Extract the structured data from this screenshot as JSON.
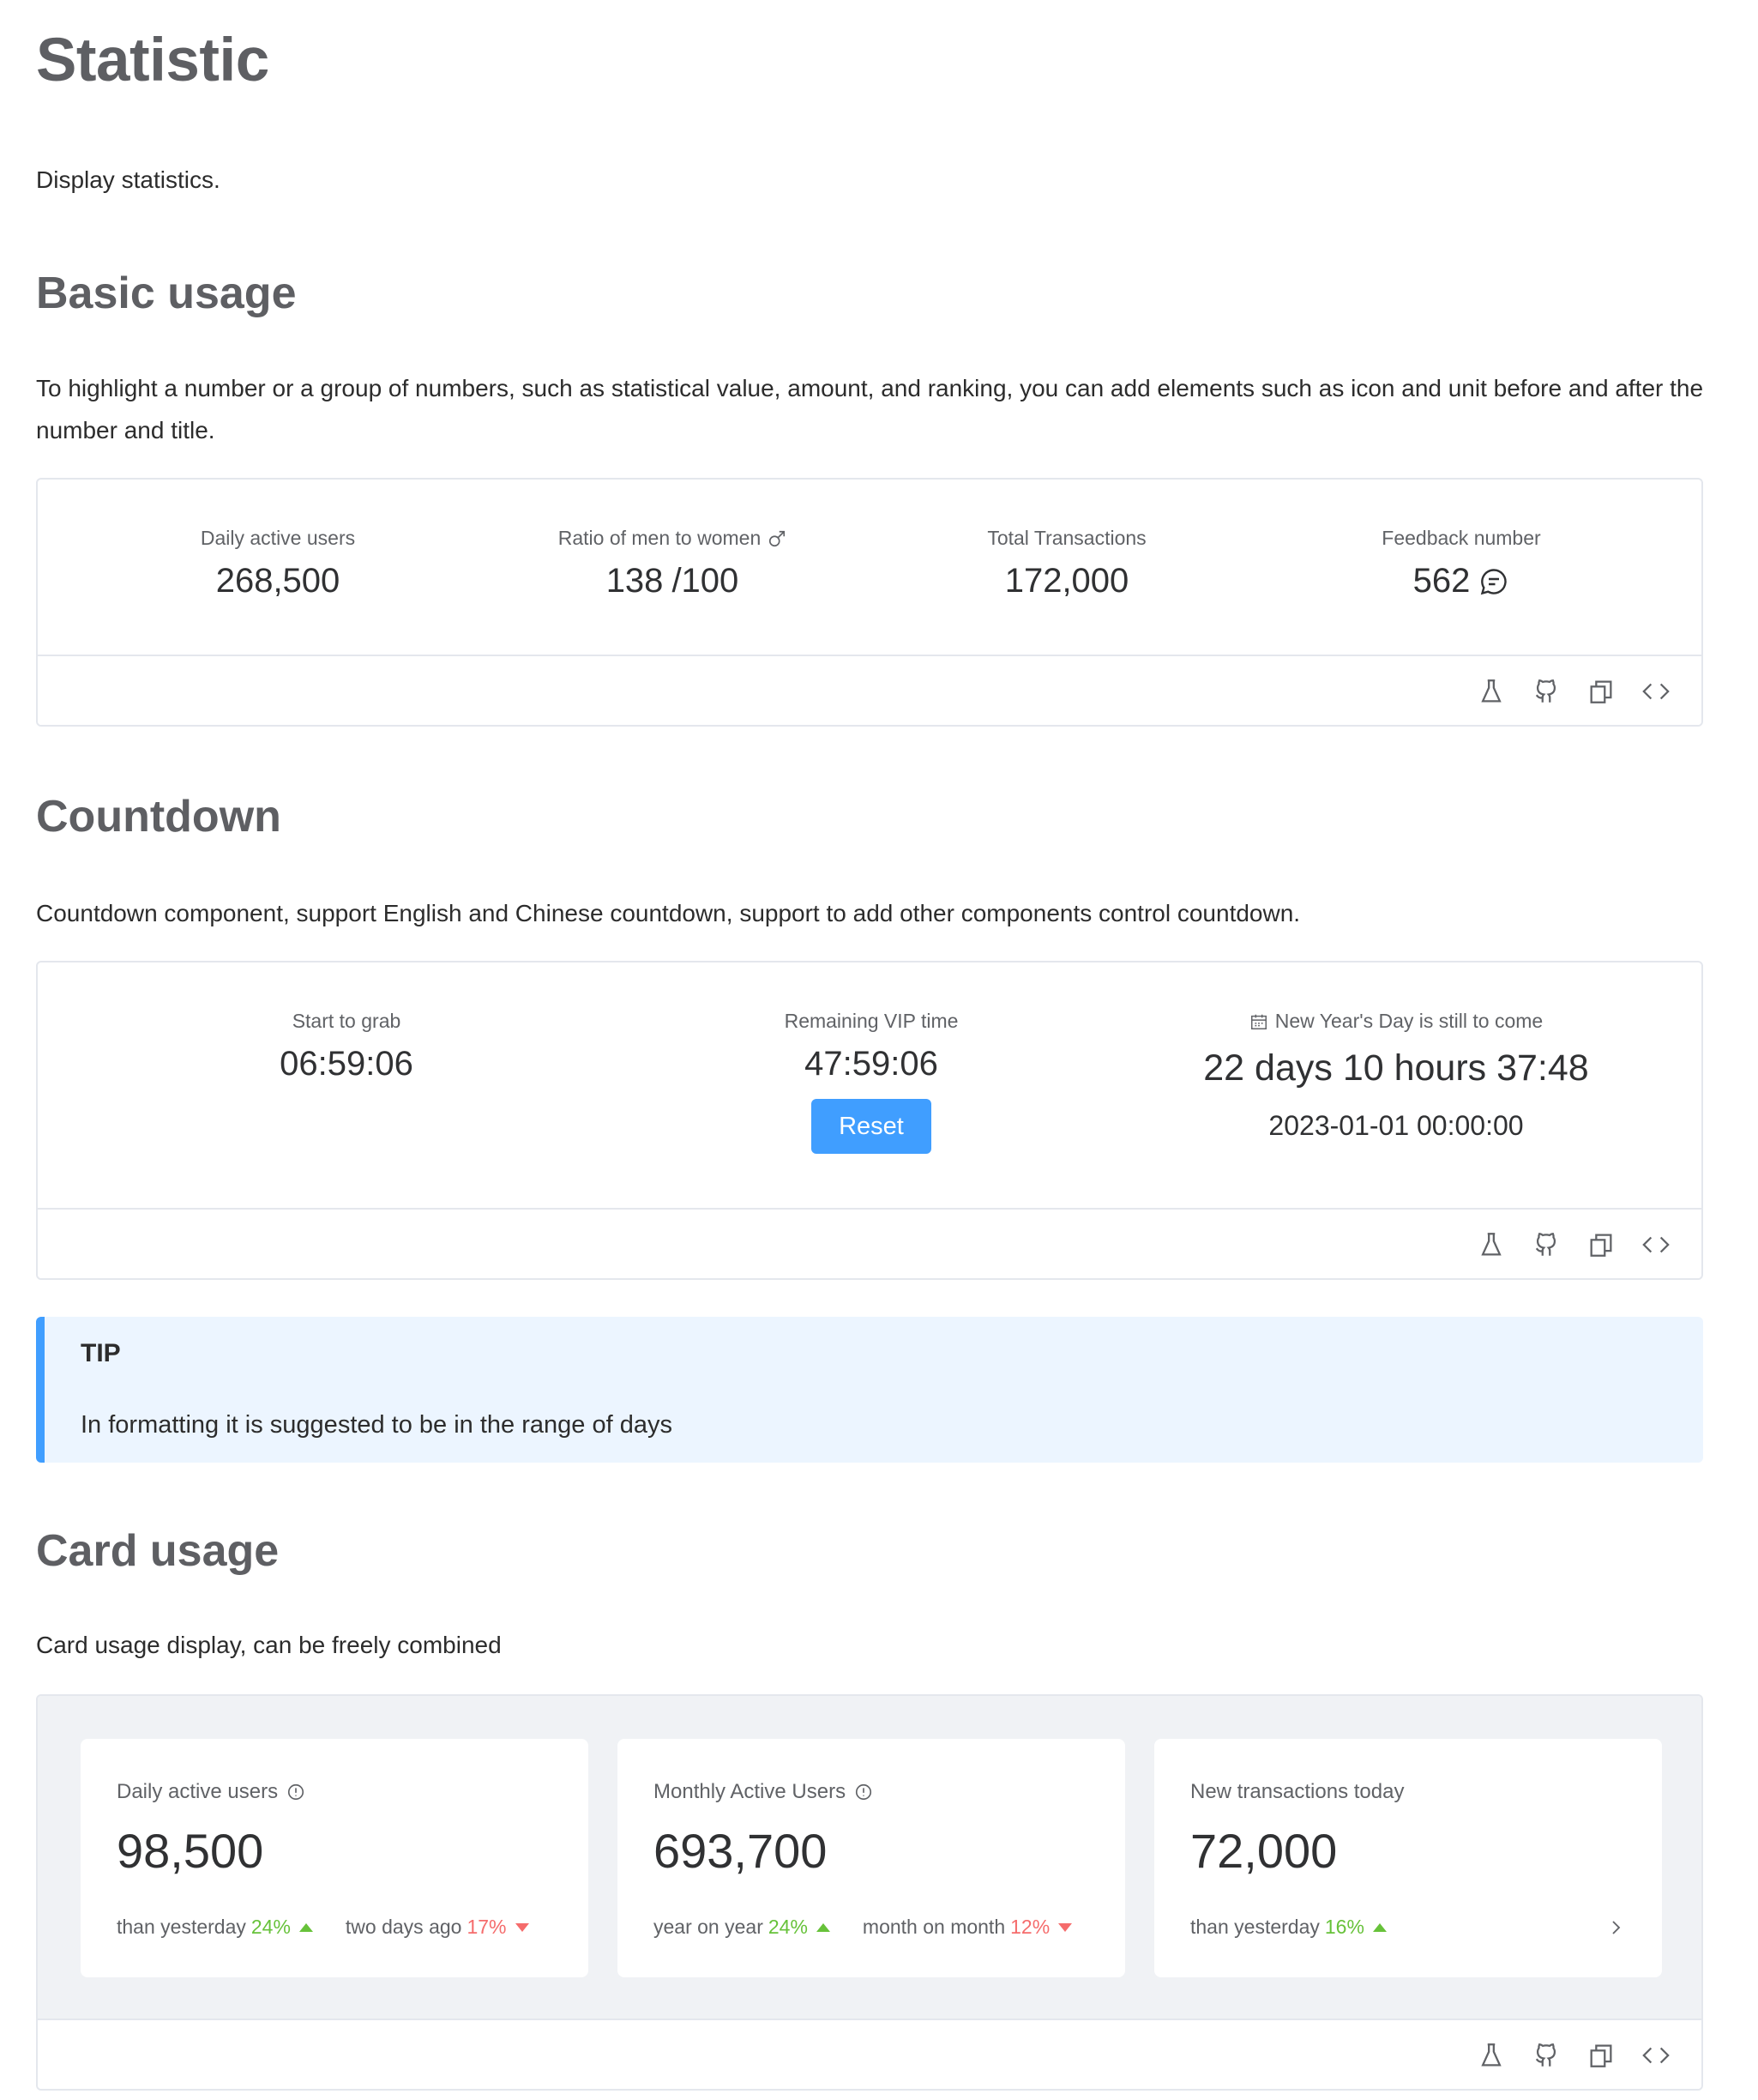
{
  "page": {
    "title": "Statistic",
    "description": "Display statistics."
  },
  "basic": {
    "heading": "Basic usage",
    "description": "To highlight a number or a group of numbers, such as statistical value, amount, and ranking, you can add elements such as icon and unit before and after the number and title.",
    "stats": [
      {
        "title": "Daily active users",
        "value": "268,500"
      },
      {
        "title": "Ratio of men to women",
        "icon": "male-icon",
        "value": "138",
        "suffix": "/100"
      },
      {
        "title": "Total Transactions",
        "value": "172,000"
      },
      {
        "title": "Feedback number",
        "value": "562",
        "icon": "chat-icon"
      }
    ]
  },
  "countdown": {
    "heading": "Countdown",
    "description": "Countdown component, support English and Chinese countdown, support to add other components control countdown.",
    "items": [
      {
        "title": "Start to grab",
        "value": "06:59:06"
      },
      {
        "title": "Remaining VIP time",
        "value": "47:59:06",
        "button": "Reset"
      },
      {
        "title": "New Year's Day is still to come",
        "icon": "calendar-icon",
        "value": "22 days 10 hours 37:48",
        "date": "2023-01-01 00:00:00"
      }
    ]
  },
  "tip": {
    "title": "TIP",
    "text": "In formatting it is suggested to be in the range of days"
  },
  "card_usage": {
    "heading": "Card usage",
    "description": "Card usage display, can be freely combined",
    "cards": [
      {
        "title": "Daily active users",
        "value": "98,500",
        "compare": [
          {
            "label": "than yesterday",
            "pct": "24%",
            "trend": "up"
          },
          {
            "label": "two days ago",
            "pct": "17%",
            "trend": "down"
          }
        ]
      },
      {
        "title": "Monthly Active Users",
        "value": "693,700",
        "compare": [
          {
            "label": "year on year",
            "pct": "24%",
            "trend": "up"
          },
          {
            "label": "month on month",
            "pct": "12%",
            "trend": "down"
          }
        ]
      },
      {
        "title": "New transactions today",
        "value": "72,000",
        "compare": [
          {
            "label": "than yesterday",
            "pct": "16%",
            "trend": "up"
          }
        ]
      }
    ]
  },
  "colors": {
    "primary": "#409eff",
    "success": "#67c23a",
    "danger": "#f56c6c",
    "border": "#e4e7ed",
    "heading": "#5e5f63"
  },
  "toolbar_icons": [
    "flask-icon",
    "github-icon",
    "copy-icon",
    "code-icon"
  ]
}
